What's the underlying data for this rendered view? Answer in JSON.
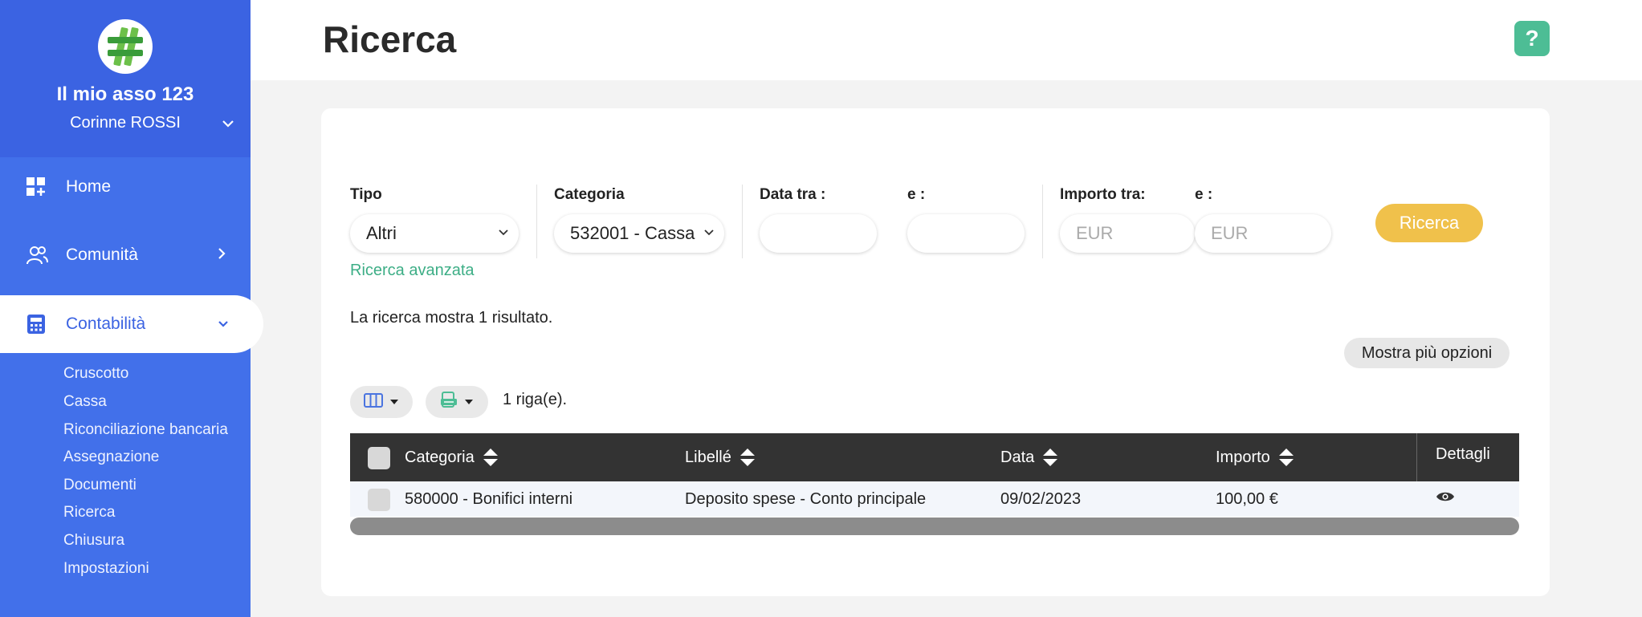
{
  "sidebar": {
    "org_name": "Il mio asso 123",
    "user_name": "Corinne ROSSI",
    "nav": [
      {
        "label": "Home",
        "icon": "dashboard-icon"
      },
      {
        "label": "Comunità",
        "icon": "users-icon"
      },
      {
        "label": "Contabilità",
        "icon": "calculator-icon"
      }
    ],
    "sub_items": [
      "Cruscotto",
      "Cassa",
      "Riconciliazione bancaria",
      "Assegnazione",
      "Documenti",
      "Ricerca",
      "Chiusura",
      "Impostazioni"
    ]
  },
  "header": {
    "title": "Ricerca",
    "help_label": "?"
  },
  "filters": {
    "type_label": "Tipo",
    "type_value": "Altri",
    "category_label": "Categoria",
    "category_value": "532001 - Cassa",
    "date_between_label": "Data tra :",
    "date_and_label": "e :",
    "amount_between_label": "Importo tra:",
    "amount_and_label": "e :",
    "amount_placeholder": "EUR",
    "advanced_link": "Ricerca avanzata",
    "search_button": "Ricerca"
  },
  "results": {
    "summary": "La ricerca mostra 1 risultato.",
    "more_options": "Mostra più opzioni",
    "rows_count": "1 riga(e)."
  },
  "table": {
    "headers": {
      "category": "Categoria",
      "label": "Libellé",
      "date": "Data",
      "amount": "Importo",
      "details": "Dettagli"
    },
    "rows": [
      {
        "category": "580000 - Bonifici interni",
        "label": "Deposito spese - Conto principale",
        "date": "09/02/2023",
        "amount": "100,00 €"
      }
    ]
  },
  "colors": {
    "sidebar": "#4270ea",
    "accent_green": "#4dbd95",
    "search_button": "#f0c14b",
    "table_header": "#333333"
  }
}
